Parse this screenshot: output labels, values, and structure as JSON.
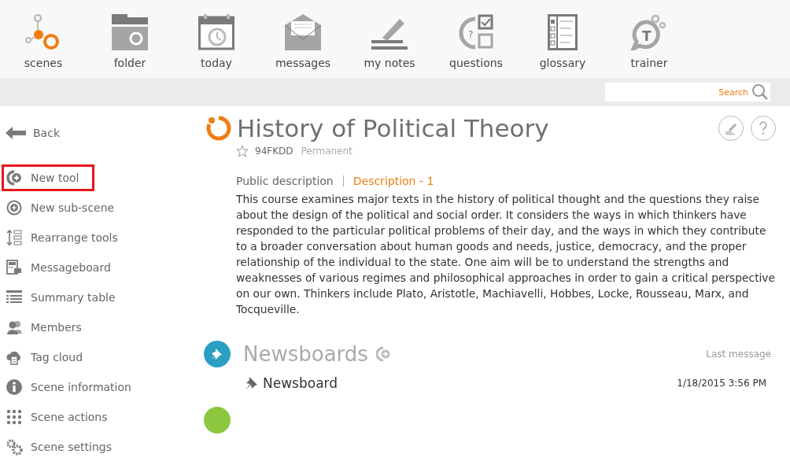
{
  "nav": [
    {
      "label": "scenes",
      "kind": "scenes"
    },
    {
      "label": "folder",
      "kind": "folder"
    },
    {
      "label": "today",
      "kind": "today"
    },
    {
      "label": "messages",
      "kind": "messages"
    },
    {
      "label": "my notes",
      "kind": "notes"
    },
    {
      "label": "questions",
      "kind": "questions",
      "icon_text": "?"
    },
    {
      "label": "glossary",
      "kind": "glossary"
    },
    {
      "label": "trainer",
      "kind": "trainer",
      "icon_text": "T"
    }
  ],
  "search": {
    "placeholder": "Search"
  },
  "sidebar": {
    "back": "Back",
    "items": [
      {
        "label": "New tool",
        "kind": "newtool",
        "highlighted": true
      },
      {
        "label": "New sub-scene",
        "kind": "subscene",
        "highlighted": false
      },
      {
        "label": "Rearrange tools",
        "kind": "rearrange",
        "highlighted": false
      },
      {
        "label": "Messageboard",
        "kind": "messageboard",
        "highlighted": false
      },
      {
        "label": "Summary table",
        "kind": "summary",
        "highlighted": false
      },
      {
        "label": "Members",
        "kind": "members",
        "highlighted": false
      },
      {
        "label": "Tag cloud",
        "kind": "tagcloud",
        "highlighted": false
      },
      {
        "label": "Scene information",
        "kind": "info",
        "highlighted": false
      },
      {
        "label": "Scene actions",
        "kind": "actions",
        "highlighted": false
      },
      {
        "label": "Scene settings",
        "kind": "settings",
        "highlighted": false
      }
    ]
  },
  "scene": {
    "title": "History of Political Theory",
    "code": "94FKDD",
    "status": "Permanent",
    "favorite": false,
    "tabs": [
      {
        "label": "Public description",
        "selected": false
      },
      {
        "label": "Description - 1",
        "selected": true
      }
    ],
    "description": "This course examines major texts in the history of political thought and the questions they raise about the design of the political and social order. It considers the ways in which thinkers have responded to the particular political problems of their day, and the ways in which they contribute to a broader conversation about human goods and needs, justice, democracy, and the proper relationship of the individual to the state. One aim will be to understand the strengths and weaknesses of various regimes and philosophical approaches in order to gain a critical perspective on our own. Thinkers include Plato, Aristotle, Machiavelli, Hobbes, Locke, Rousseau, Marx, and Tocqueville."
  },
  "sections": [
    {
      "title": "Newsboards",
      "color": "#2b9ec4",
      "column_label": "Last message",
      "items": [
        {
          "name": "Newsboard",
          "date": "1/18/2015 3:56 PM"
        }
      ]
    },
    {
      "color": "#8dc63f"
    }
  ]
}
